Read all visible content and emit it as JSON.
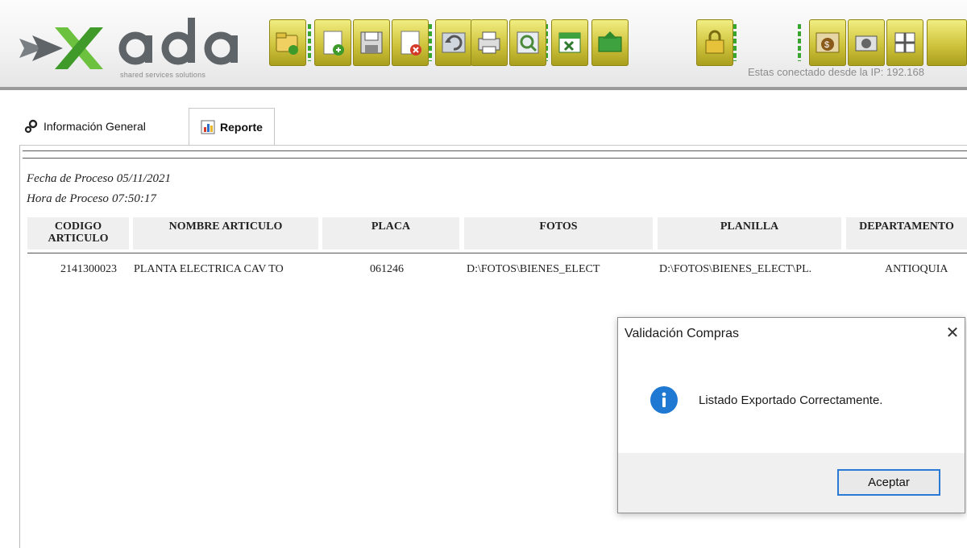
{
  "app": {
    "logo_text": "ada",
    "tagline": "shared services solutions",
    "ip_text": "Estas conectado desde la IP: 192.168"
  },
  "toolbar": {
    "buttons": [
      {
        "icon": "folder-open-icon"
      },
      {
        "icon": "add-icon"
      },
      {
        "icon": "save-icon"
      },
      {
        "icon": "delete-icon"
      },
      {
        "icon": "undo-icon"
      },
      {
        "icon": "print-icon"
      },
      {
        "icon": "preview-icon"
      },
      {
        "icon": "excel-export-icon"
      },
      {
        "icon": "send-icon"
      },
      {
        "icon": "lock-icon"
      },
      {
        "icon": "money-bag-icon"
      },
      {
        "icon": "camera-icon"
      },
      {
        "icon": "grid-icon"
      }
    ]
  },
  "tabs": {
    "info_label": "Información General",
    "report_label": "Reporte"
  },
  "report": {
    "fecha_label": "Fecha de Proceso",
    "fecha_value": "05/11/2021",
    "hora_label": "Hora de Proceso",
    "hora_value": "07:50:17",
    "columns": [
      "CODIGO ARTICULO",
      "NOMBRE ARTICULO",
      "PLACA",
      "FOTOS",
      "PLANILLA",
      "DEPARTAMENTO"
    ],
    "rows": [
      [
        "2141300023",
        "PLANTA ELECTRICA CAV TO",
        "061246",
        "D:\\FOTOS\\BIENES_ELECT",
        "D:\\FOTOS\\BIENES_ELECT\\PL.",
        "ANTIOQUIA"
      ]
    ]
  },
  "dialog": {
    "title": "Validación Compras",
    "message": "Listado Exportado Correctamente.",
    "button": "Aceptar",
    "close_glyph": "✕"
  },
  "colors": {
    "toolbar_button": "#cfc43d",
    "logo_green": "#6cc23e",
    "logo_dark": "#5f6468",
    "info_icon": "#1f78d1",
    "accent_border": "#2a7ad5"
  }
}
